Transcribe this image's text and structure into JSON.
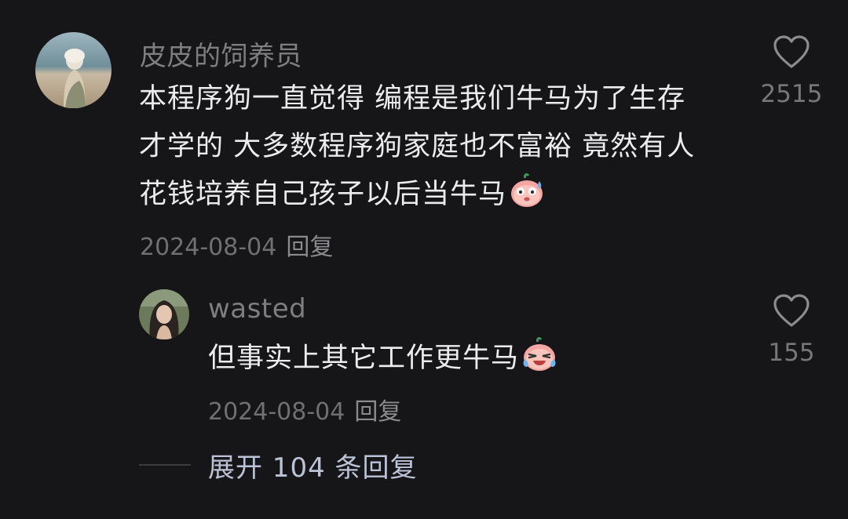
{
  "colors": {
    "background": "#161619",
    "username": "#7d7d82",
    "body_text": "#ececee",
    "meta_text": "#6f6f74",
    "expand_text": "#bcc3d6"
  },
  "comment": {
    "avatar_icon": "user-avatar-photo",
    "username": "皮皮的饲养员",
    "text_lines": [
      "本程序狗一直觉得 编程是我们牛马为了生存",
      "才学的 大多数程序狗家庭也不富裕 竟然有人",
      "花钱培养自己孩子以后当牛马"
    ],
    "emoji": "sweat-face-emoji",
    "date": "2024-08-04",
    "reply_label": "回复",
    "like_icon": "heart-icon",
    "like_count": "2515"
  },
  "reply": {
    "avatar_icon": "user-avatar-photo",
    "username": "wasted",
    "text": "但事实上其它工作更牛马",
    "emoji": "crying-laughing-emoji",
    "date": "2024-08-04",
    "reply_label": "回复",
    "like_icon": "heart-icon",
    "like_count": "155"
  },
  "expand": {
    "label": "展开 104 条回复"
  }
}
